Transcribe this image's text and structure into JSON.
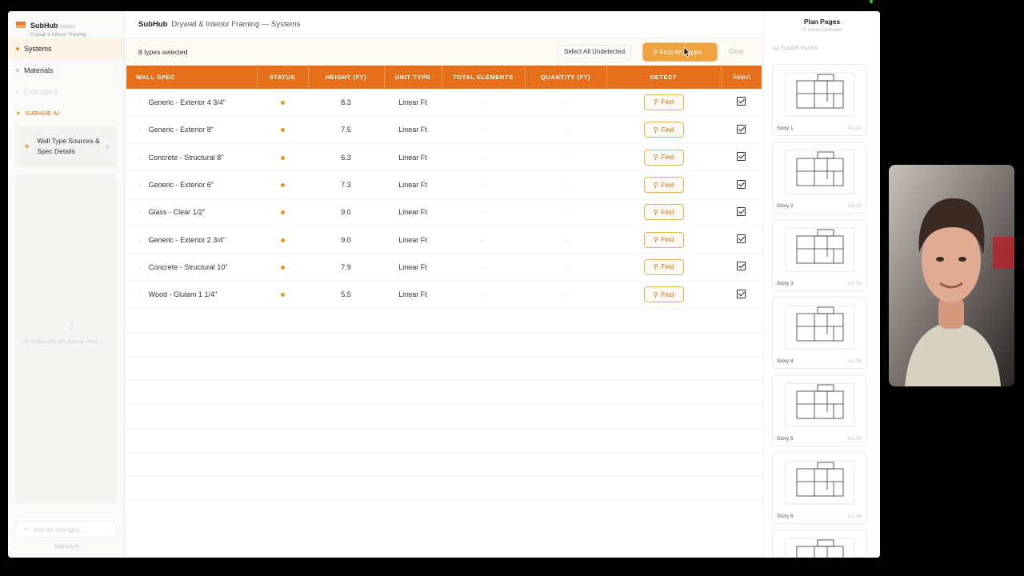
{
  "brand": {
    "name": "SubHub",
    "tag": "Control",
    "subtitle": "Drywall & Interior Framing"
  },
  "sidebar": {
    "items": [
      {
        "label": "Systems"
      },
      {
        "label": "Materials"
      },
      {
        "label": "Estimating"
      }
    ],
    "ai_heading": "SUBHUB AI",
    "ai_card_label": "Wall Type Sources & Spec Details",
    "ai_empty": "AI responses will appear here",
    "ai_input_placeholder": "Ask for changes...",
    "ai_footer": "SubHub AI"
  },
  "header": {
    "app": "SubHub",
    "breadcrumb": "Drywall & Interior Framing — Systems"
  },
  "toolbar": {
    "selected": "8 types selected",
    "select_undetected": "Select All Undetected",
    "find_all": "Find All Types",
    "clear": "Clear"
  },
  "table": {
    "columns": [
      "WALL SPEC",
      "STATUS",
      "HEIGHT (FT)",
      "UNIT TYPE",
      "TOTAL ELEMENTS",
      "QUANTITY (FT)",
      "DETECT",
      "Select"
    ],
    "find_label": "Find",
    "dash": "—",
    "rows": [
      {
        "spec": "Generic - Exterior 4 3/4\"",
        "height": "8.3",
        "unit": "Linear Ft"
      },
      {
        "spec": "Generic - Exterior 8\"",
        "height": "7.5",
        "unit": "Linear Ft"
      },
      {
        "spec": "Concrete - Structural 8\"",
        "height": "6.3",
        "unit": "Linear Ft"
      },
      {
        "spec": "Generic - Exterior 6\"",
        "height": "7.3",
        "unit": "Linear Ft"
      },
      {
        "spec": "Glass - Clear 1/2\"",
        "height": "9.0",
        "unit": "Linear Ft"
      },
      {
        "spec": "Generic - Exterior 2 3/4\"",
        "height": "9.0",
        "unit": "Linear Ft"
      },
      {
        "spec": "Concrete - Structural 10\"",
        "height": "7.9",
        "unit": "Linear Ft"
      },
      {
        "spec": "Wood - Glulam 1 1/4\"",
        "height": "5.5",
        "unit": "Linear Ft"
      }
    ]
  },
  "plans": {
    "title": "Plan Pages",
    "subtitle": "25 sheets uploaded",
    "section": "A2 FLOOR PLANS",
    "pages": [
      {
        "name": "Story 1",
        "code": "A2.01"
      },
      {
        "name": "Story 2",
        "code": "A2.02"
      },
      {
        "name": "Story 3",
        "code": "A2.03"
      },
      {
        "name": "Story 4",
        "code": "A2.04"
      },
      {
        "name": "Story 5",
        "code": "A2.05"
      },
      {
        "name": "Story 6",
        "code": "A2.06"
      }
    ]
  },
  "colors": {
    "accent": "#e56f1a",
    "status_dot": "#e3961f",
    "find_all_bg": "#efa23e"
  }
}
